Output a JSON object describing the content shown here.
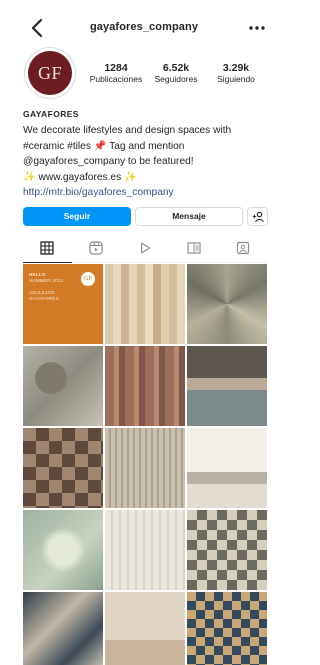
{
  "header": {
    "username": "gayafores_company"
  },
  "profile": {
    "avatar_text": "GF",
    "stats": [
      {
        "value": "1284",
        "label": "Publicaciones"
      },
      {
        "value": "6.52k",
        "label": "Seguidores"
      },
      {
        "value": "3.29k",
        "label": "Siguiendo"
      }
    ],
    "display_name": "GAYAFORES",
    "bio_line1": "We decorate lifestyles and design spaces with",
    "bio_line2": "#ceramic #tiles 📌 Tag and mention",
    "bio_line3": "@gayafores_company to be featured!",
    "bio_line4": "✨ www.gayafores.es ✨",
    "link": "http://mtr.bio/gayafores_company"
  },
  "actions": {
    "follow_label": "Seguir",
    "message_label": "Mensaje"
  },
  "tabs": [
    "grid-icon",
    "reels-icon",
    "play-icon",
    "guide-icon",
    "tagged-icon"
  ],
  "grid": {
    "post1_lines": [
      "HELLO",
      "SUMMER 2021",
      "",
      "AZULEJOS",
      "GAYAFORES"
    ],
    "post1_logo": "GF"
  },
  "colors": {
    "primary_button": "#0095f6",
    "avatar_bg": "#6b1d22",
    "link": "#385185",
    "first_post_bg": "#d37a26"
  }
}
